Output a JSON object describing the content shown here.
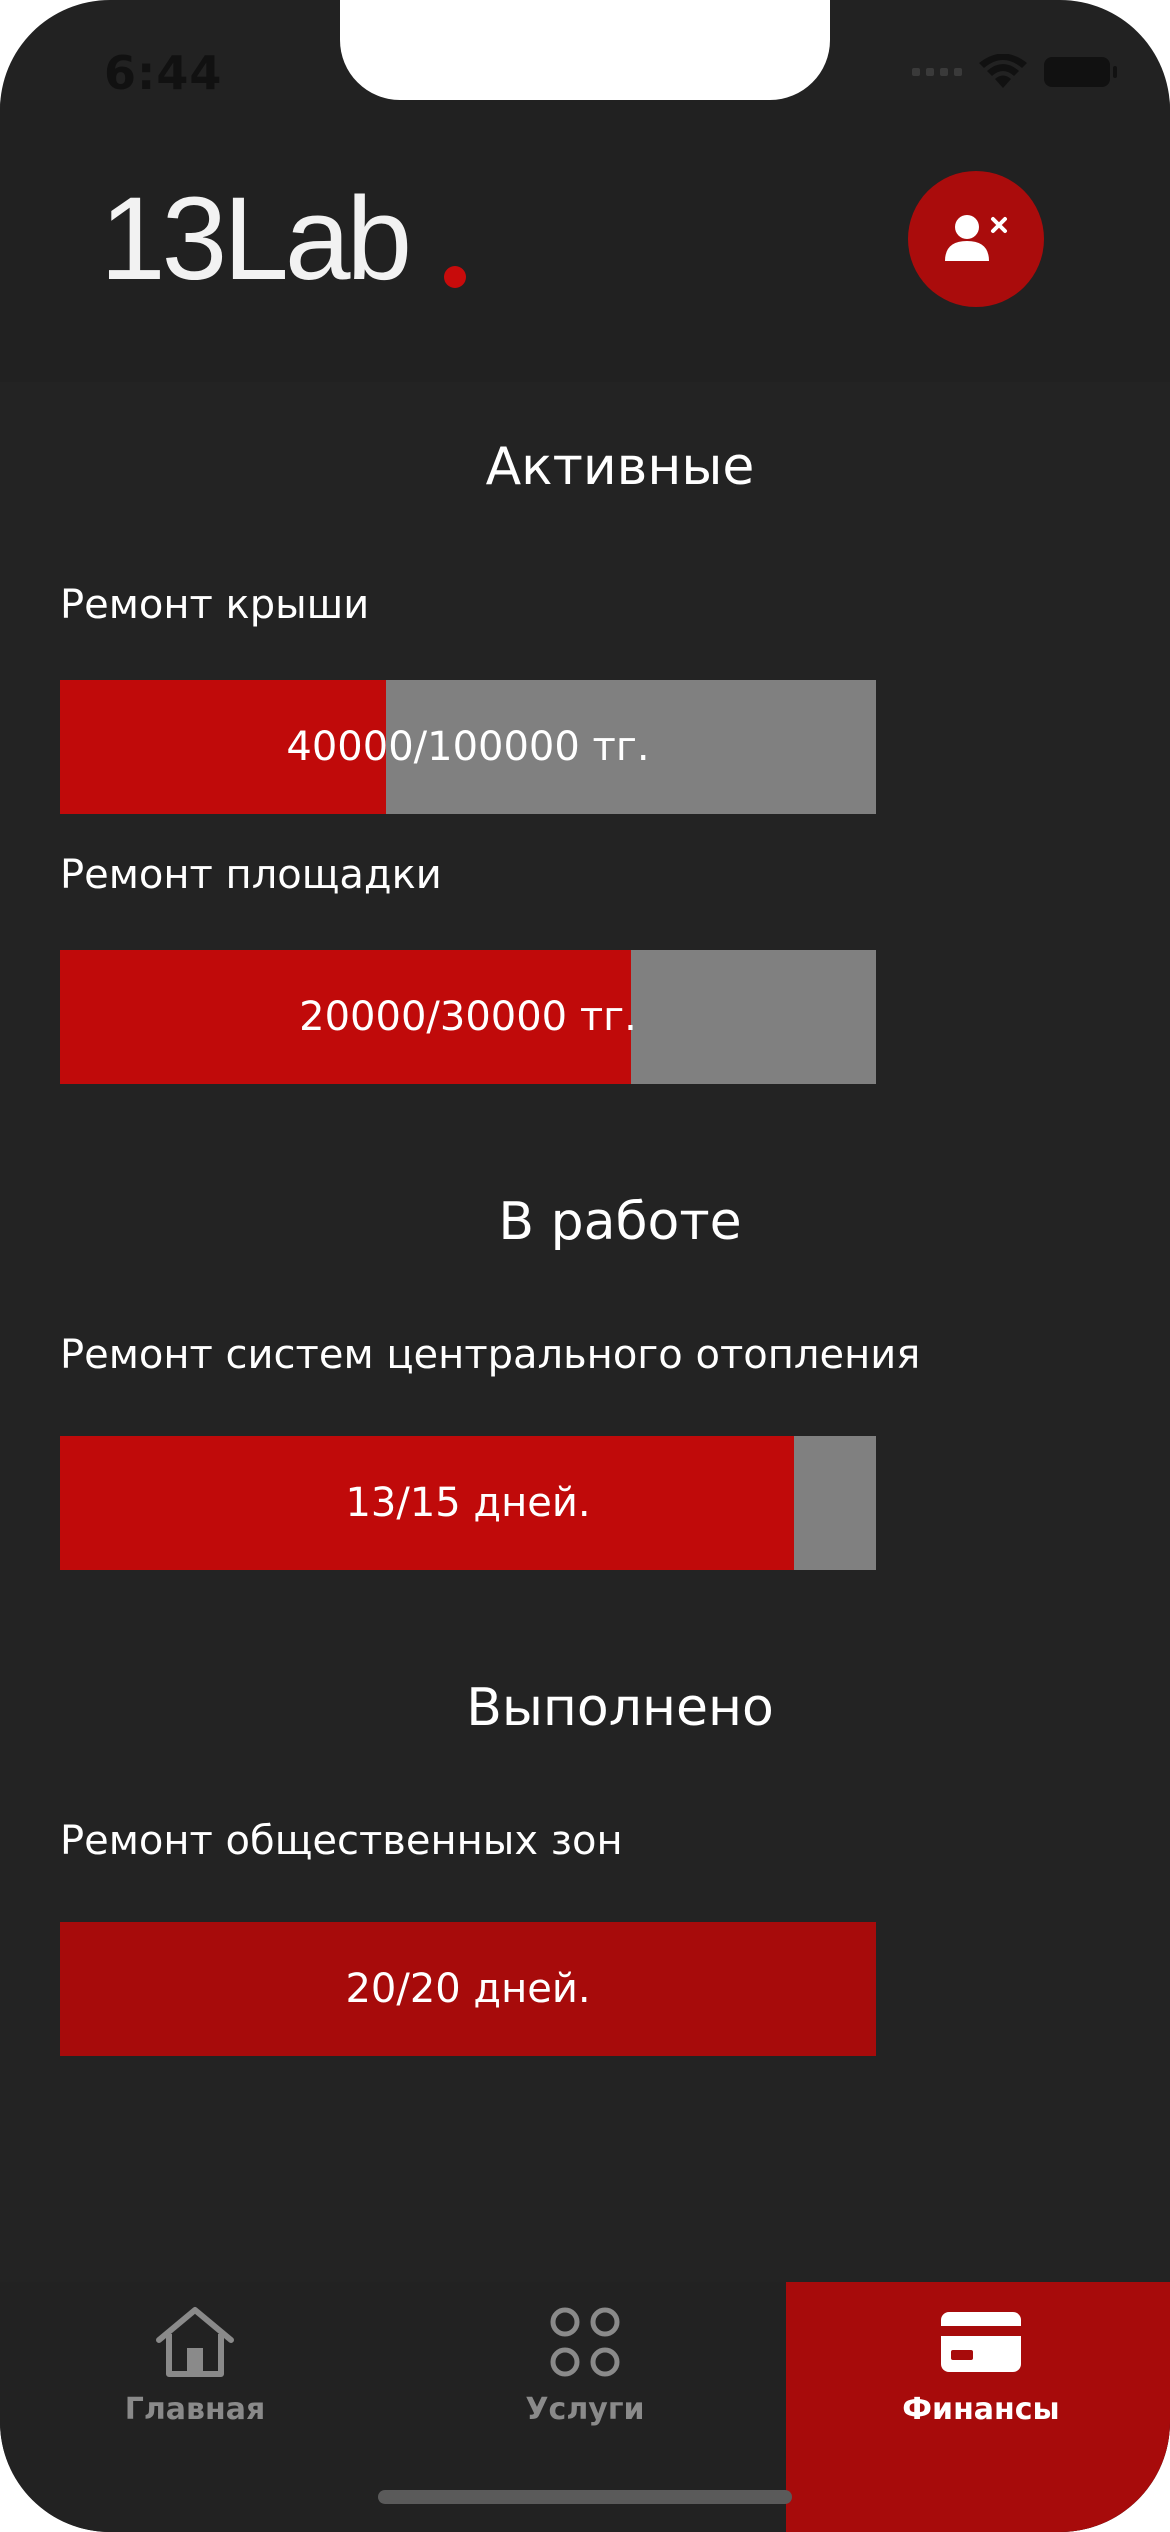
{
  "status_bar": {
    "time": "6:44"
  },
  "header": {
    "logo_text": "13Lab",
    "logout_icon": "user-remove-icon"
  },
  "sections": [
    {
      "title": "Активные",
      "items": [
        {
          "label": "Ремонт крыши",
          "progress_text": "40000/100000 тг.",
          "progress": 0.4
        },
        {
          "label": "Ремонт площадки",
          "progress_text": "20000/30000 тг.",
          "progress": 0.7
        }
      ]
    },
    {
      "title": "В работе",
      "items": [
        {
          "label": "Ремонт систем центрального отопления",
          "progress_text": "13/15 дней.",
          "progress": 0.9
        }
      ]
    },
    {
      "title": "Выполнено",
      "items": [
        {
          "label": "Ремонт общественных зон",
          "progress_text": "20/20 дней.",
          "progress": 1.0
        }
      ]
    }
  ],
  "tabbar": {
    "tabs": [
      {
        "label": "Главная",
        "icon": "home-icon",
        "active": false
      },
      {
        "label": "Услуги",
        "icon": "grid-icon",
        "active": false
      },
      {
        "label": "Финансы",
        "icon": "card-icon",
        "active": true
      }
    ]
  },
  "colors": {
    "accent": "#c00a0a",
    "accent_dark": "#a70b0b",
    "track": "#808080",
    "background": "#232323"
  }
}
